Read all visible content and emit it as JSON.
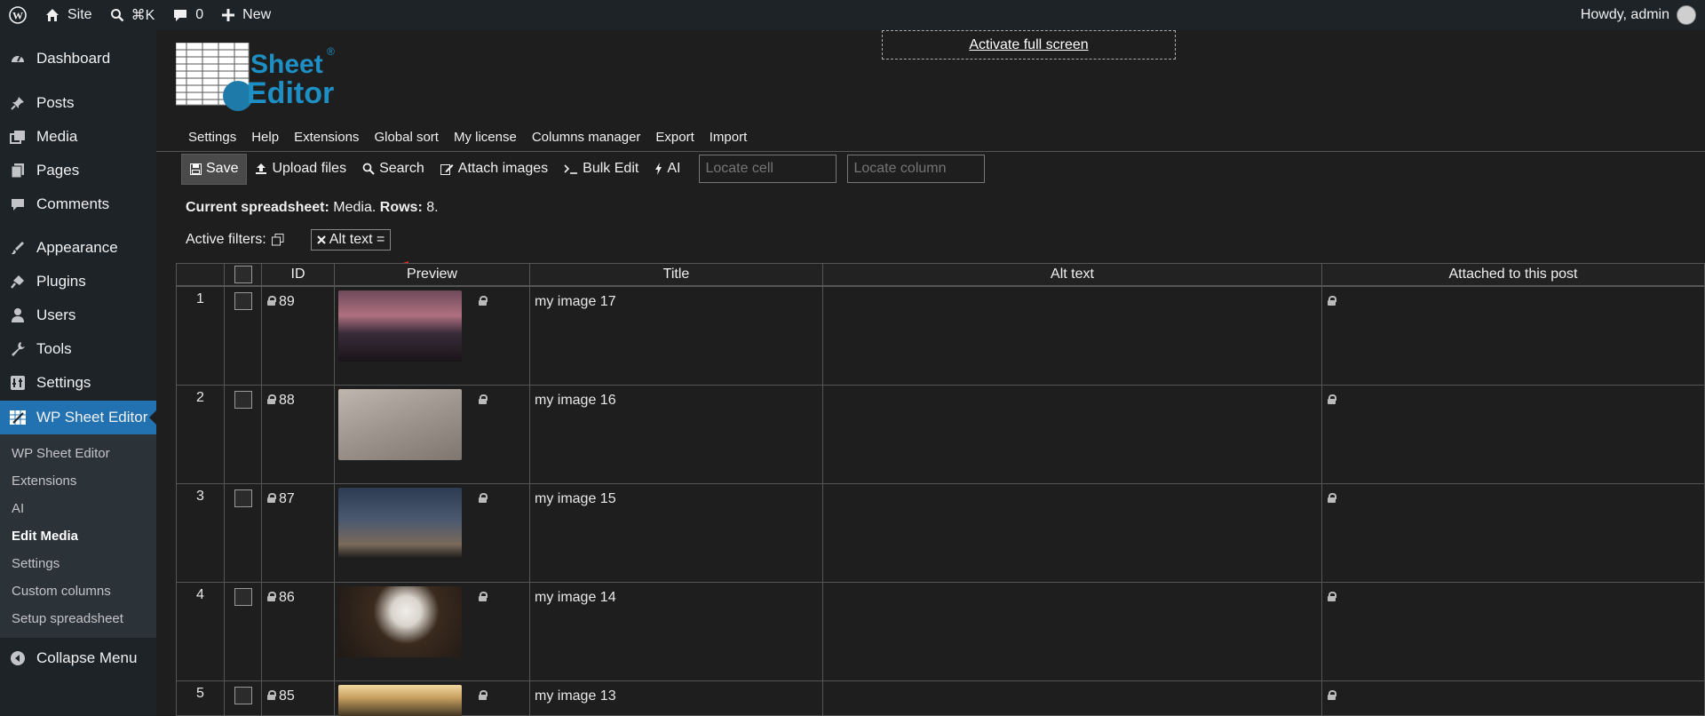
{
  "adminbar": {
    "site_label": "Site",
    "search_shortcut": "⌘K",
    "comments_count": "0",
    "new_label": "New",
    "howdy": "Howdy, admin"
  },
  "sidebar": {
    "items": [
      {
        "label": "Dashboard",
        "icon": "dashboard-icon"
      },
      {
        "label": "Posts",
        "icon": "pin-icon"
      },
      {
        "label": "Media",
        "icon": "media-icon"
      },
      {
        "label": "Pages",
        "icon": "pages-icon"
      },
      {
        "label": "Comments",
        "icon": "comments-icon"
      },
      {
        "label": "Appearance",
        "icon": "appearance-icon"
      },
      {
        "label": "Plugins",
        "icon": "plugins-icon"
      },
      {
        "label": "Users",
        "icon": "users-icon"
      },
      {
        "label": "Tools",
        "icon": "tools-icon"
      },
      {
        "label": "Settings",
        "icon": "settings-icon"
      },
      {
        "label": "WP Sheet Editor",
        "icon": "sheet-editor-icon"
      }
    ],
    "submenu": [
      "WP Sheet Editor",
      "Extensions",
      "AI",
      "Edit Media",
      "Settings",
      "Custom columns",
      "Setup spreadsheet"
    ],
    "collapse_label": "Collapse Menu"
  },
  "logo": {
    "line1": "Sheet",
    "line2": "Editor",
    "reg": "®"
  },
  "fullscreen_label": "Activate full screen",
  "topmenu": [
    "Settings",
    "Help",
    "Extensions",
    "Global sort",
    "My license",
    "Columns manager",
    "Export",
    "Import"
  ],
  "toolbar": {
    "save": "Save",
    "upload": "Upload files",
    "search": "Search",
    "attach": "Attach images",
    "bulk": "Bulk Edit",
    "ai": "AI",
    "locate_cell_placeholder": "Locate cell",
    "locate_column_placeholder": "Locate column"
  },
  "status": {
    "label": "Current spreadsheet:",
    "value": "Media.",
    "rows_label": "Rows:",
    "rows_value": "8."
  },
  "filters": {
    "label": "Active filters:",
    "tag": "Alt text ="
  },
  "columns": [
    "ID",
    "Preview",
    "Title",
    "Alt text",
    "Attached to this post"
  ],
  "rows": [
    {
      "num": "1",
      "id": "89",
      "title": "my image 17"
    },
    {
      "num": "2",
      "id": "88",
      "title": "my image 16"
    },
    {
      "num": "3",
      "id": "87",
      "title": "my image 15"
    },
    {
      "num": "4",
      "id": "86",
      "title": "my image 14"
    },
    {
      "num": "5",
      "id": "85",
      "title": "my image 13"
    }
  ],
  "colors": {
    "accent": "#2271b1",
    "adminbar": "#1d2327",
    "arrow": "#e02424"
  }
}
